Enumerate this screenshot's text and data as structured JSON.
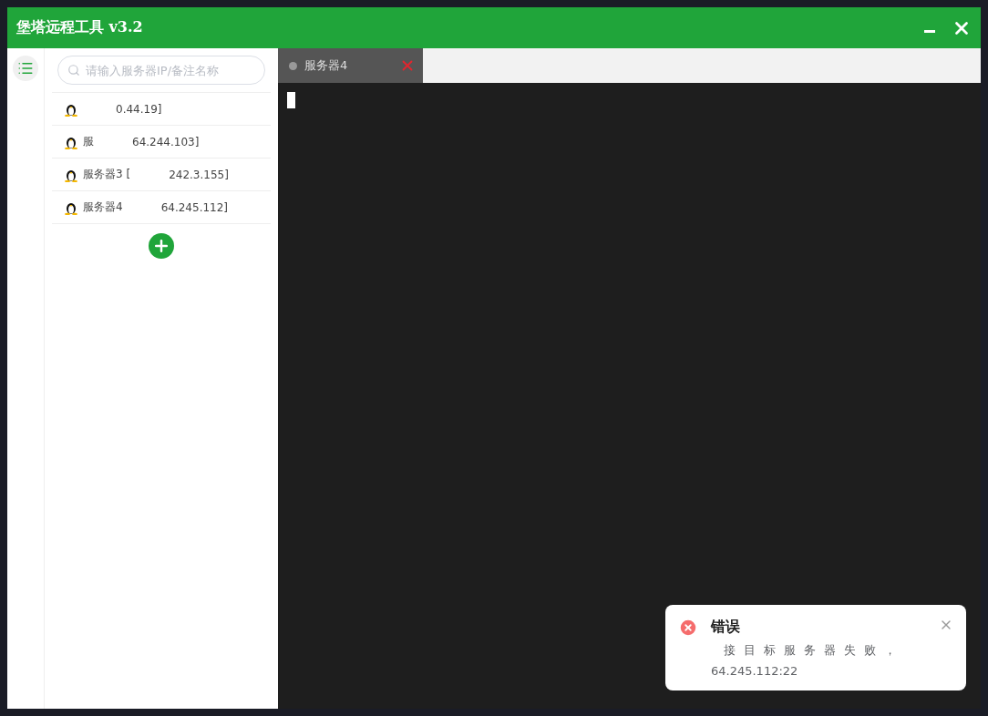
{
  "window": {
    "title": "堡塔远程工具 v3.2"
  },
  "search": {
    "placeholder": "请输入服务器IP/备注名称"
  },
  "servers": [
    {
      "address": "0.44.19]"
    },
    {
      "name": "服",
      "address": "64.244.103]"
    },
    {
      "name": "服务器3 [",
      "address": "242.3.155]"
    },
    {
      "name": "服务器4",
      "address": "64.245.112]"
    }
  ],
  "tabs": [
    {
      "label": "服务器4",
      "selected": true
    }
  ],
  "notification": {
    "kind": "error",
    "title": "错误",
    "lines": [
      "接目标服务器失败，",
      "64.245.112:22"
    ]
  }
}
